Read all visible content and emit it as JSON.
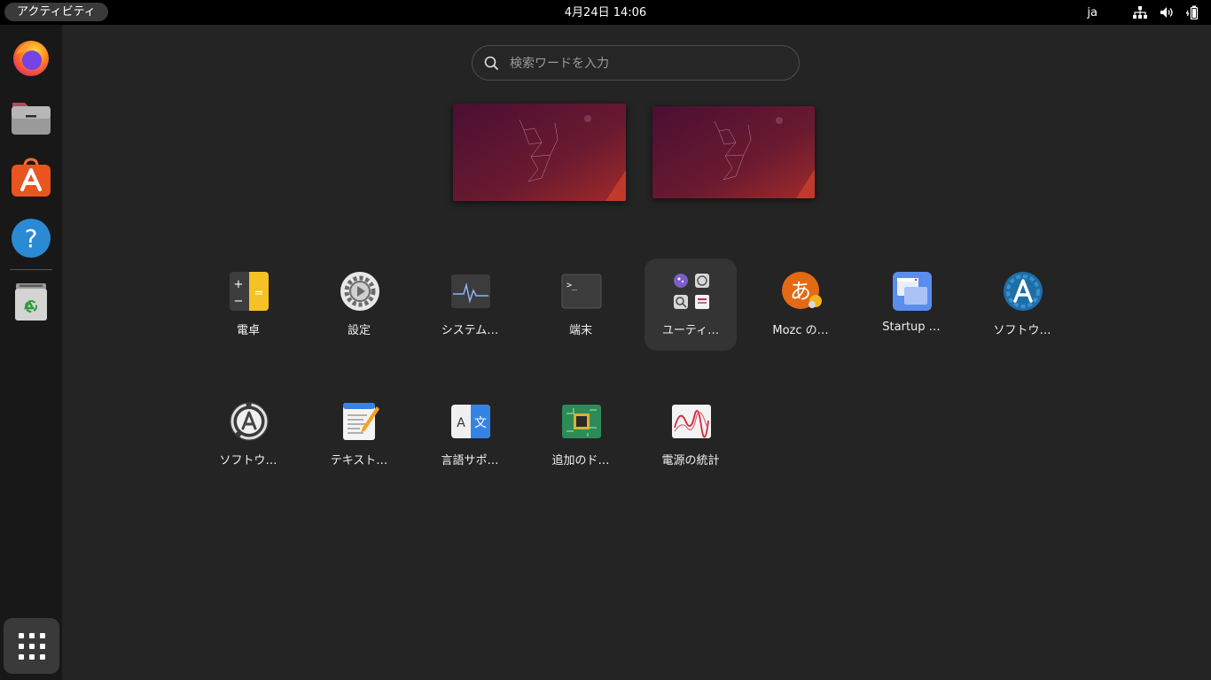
{
  "topbar": {
    "activities": "アクティビティ",
    "clock": "4月24日  14:06",
    "input_method": "ja",
    "icons": [
      "network-icon",
      "volume-icon",
      "battery-icon"
    ]
  },
  "dock": {
    "items": [
      "firefox-icon",
      "files-icon",
      "app-center-icon",
      "help-icon",
      "trash-icon"
    ],
    "show_apps": "show-apps-grid-icon"
  },
  "search": {
    "placeholder": "検索ワードを入力",
    "value": ""
  },
  "apps": [
    {
      "label": "電卓",
      "icon": "calculator-icon"
    },
    {
      "label": "設定",
      "icon": "settings-gear-icon"
    },
    {
      "label": "システム…",
      "icon": "system-monitor-icon"
    },
    {
      "label": "端末",
      "icon": "terminal-icon"
    },
    {
      "label": "ユーティ…",
      "icon": "utilities-folder-icon"
    },
    {
      "label": "Mozc の…",
      "icon": "mozc-icon"
    },
    {
      "label": "Startup …",
      "icon": "startup-disk-icon"
    },
    {
      "label": "ソフトウ…",
      "icon": "software-updater-icon"
    },
    {
      "label": "ソフトウ…",
      "icon": "software-properties-icon"
    },
    {
      "label": "テキスト…",
      "icon": "text-editor-icon"
    },
    {
      "label": "言語サポ…",
      "icon": "language-support-icon"
    },
    {
      "label": "追加のド…",
      "icon": "additional-drivers-icon"
    },
    {
      "label": "電源の統計",
      "icon": "power-statistics-icon"
    }
  ],
  "colors": {
    "background": "#242424",
    "topbar": "#000000",
    "dock": "#181818",
    "selected": "#343434"
  }
}
